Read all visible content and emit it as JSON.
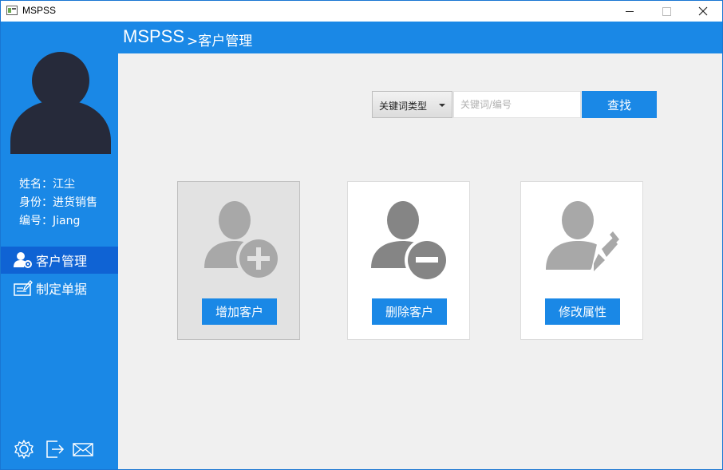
{
  "window": {
    "title": "MSPSS"
  },
  "header": {
    "app_name": "MSPSS",
    "breadcrumb": ">客户管理"
  },
  "user": {
    "name_line": "姓名：江尘",
    "role_line": "身份：进货销售",
    "id_line": "编号：Jiang"
  },
  "sidebar": {
    "items": [
      {
        "label": "客户管理",
        "icon": "user-gear-icon",
        "active": true
      },
      {
        "label": "制定单据",
        "icon": "document-edit-icon",
        "active": false
      }
    ],
    "bottom_icons": [
      "settings-icon",
      "logout-icon",
      "mail-icon"
    ]
  },
  "search": {
    "type_label": "关键词类型",
    "placeholder": "关键词/编号",
    "button_label": "查找"
  },
  "actions": [
    {
      "label": "增加客户",
      "icon": "user-add-icon"
    },
    {
      "label": "删除客户",
      "icon": "user-remove-icon"
    },
    {
      "label": "修改属性",
      "icon": "user-edit-icon"
    }
  ],
  "colors": {
    "accent": "#1a88e6",
    "active_nav": "#0f63d4",
    "avatar": "#262a3a"
  }
}
